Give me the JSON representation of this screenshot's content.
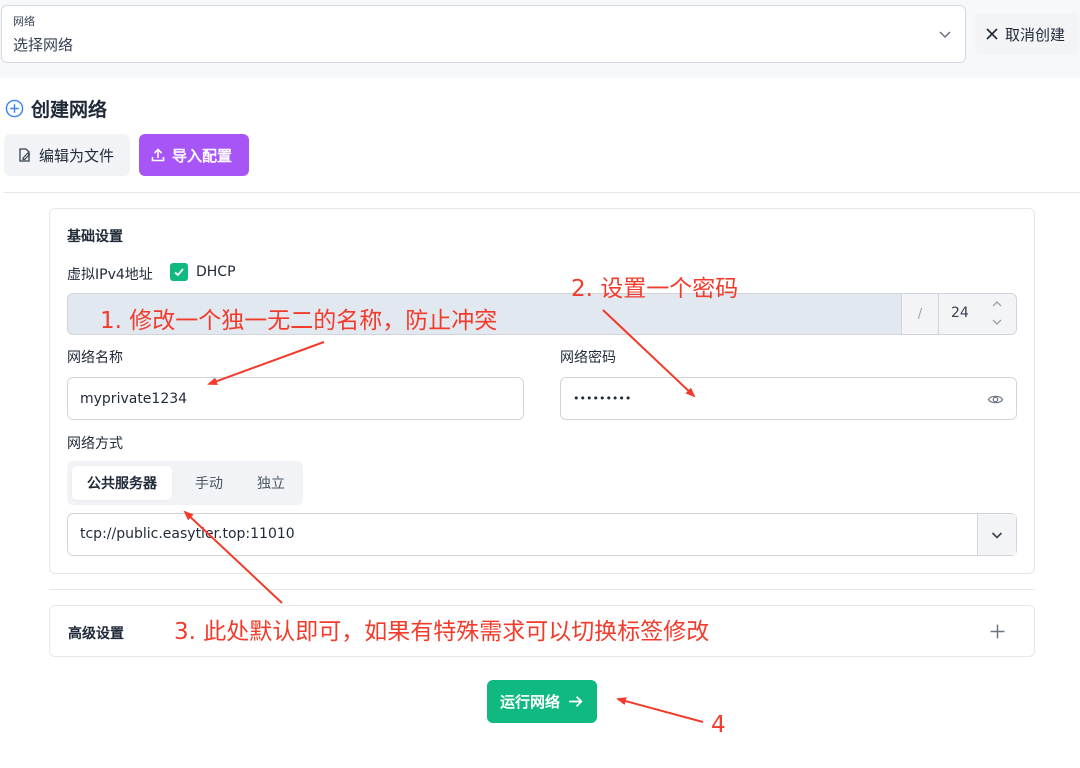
{
  "network_select": {
    "label": "网络",
    "value": "选择网络"
  },
  "cancel_label": "取消创建",
  "create_title": "创建网络",
  "toolbar": {
    "edit_label": "编辑为文件",
    "import_label": "导入配置"
  },
  "basic": {
    "title": "基础设置",
    "ipv4_label": "虚拟IPv4地址",
    "dhcp_label": "DHCP",
    "dhcp_checked": true,
    "ip_separator": "/",
    "netmask": "24",
    "name_label": "网络名称",
    "name_value": "myprivate1234",
    "password_label": "网络密码",
    "password_value": "•••••••••",
    "mode_label": "网络方式",
    "modes": [
      "公共服务器",
      "手动",
      "独立"
    ],
    "active_mode": "公共服务器",
    "server_value": "tcp://public.easytier.top:11010"
  },
  "advanced_title": "高级设置",
  "run_label": "运行网络",
  "annotations": {
    "a1": "1. 修改一个独一无二的名称，防止冲突",
    "a2": "2. 设置一个密码",
    "a3": "3. 此处默认即可，如果有特殊需求可以切换标签修改",
    "a4": "4"
  },
  "colors": {
    "accent_green": "#10b981",
    "accent_purple": "#a855f7",
    "annotation_red": "#f23b2b",
    "ip_field_bg": "#e2e8f0"
  },
  "icons": {
    "select_chevron": "chevron-down-icon",
    "cancel": "close-icon",
    "create": "plus-circle-icon",
    "edit": "edit-file-icon",
    "import": "upload-icon",
    "dhcp": "check-icon",
    "password_toggle": "eye-icon",
    "advanced": "plus-icon",
    "run": "arrow-right-icon"
  }
}
